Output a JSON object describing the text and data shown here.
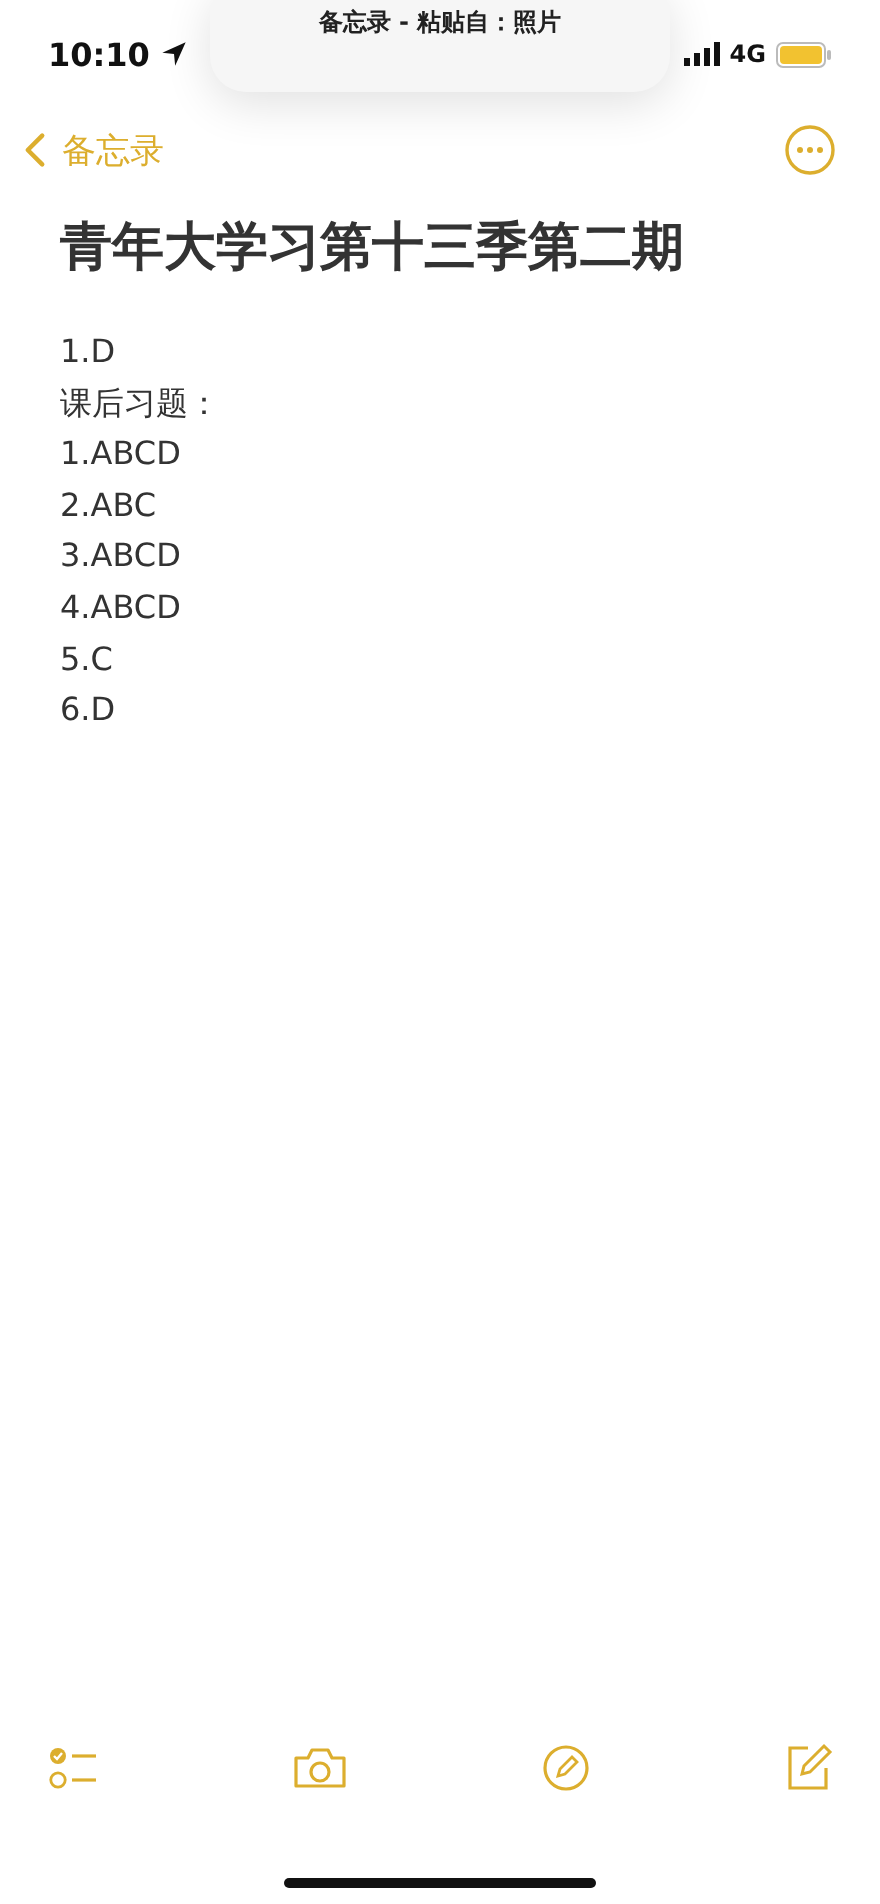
{
  "paste_banner": {
    "text": "备忘录 - 粘贴自：照片"
  },
  "status_bar": {
    "time": "10:10",
    "network": "4G"
  },
  "nav": {
    "back_label": "备忘录"
  },
  "note": {
    "title": "青年大学习第十三季第二期",
    "lines": [
      "1.D",
      "课后习题：",
      "1.ABCD",
      "2.ABC",
      "3.ABCD",
      "4.ABCD",
      "5.C",
      "6.D"
    ]
  }
}
